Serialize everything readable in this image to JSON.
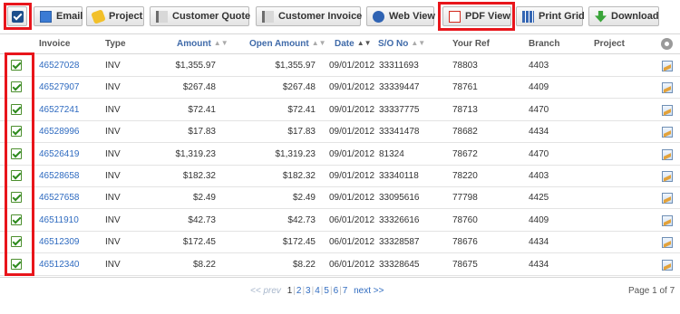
{
  "toolbar": {
    "buttons": [
      {
        "label": "Email",
        "icon": "email-icon"
      },
      {
        "label": "Project",
        "icon": "project-icon"
      },
      {
        "label": "Customer Quote",
        "icon": "quote-icon"
      },
      {
        "label": "Customer Invoice",
        "icon": "invoice-icon"
      },
      {
        "label": "Web View",
        "icon": "globe-icon"
      },
      {
        "label": "PDF View",
        "icon": "pdf-icon"
      },
      {
        "label": "Print Grid",
        "icon": "grid-icon"
      },
      {
        "label": "Download",
        "icon": "download-icon"
      }
    ],
    "highlight_color": "#e8151b"
  },
  "table": {
    "columns": {
      "invoice": "Invoice",
      "type": "Type",
      "amount": "Amount",
      "open_amount": "Open Amount",
      "date": "Date",
      "so_no": "S/O No",
      "your_ref": "Your Ref",
      "branch": "Branch",
      "project": "Project"
    },
    "rows": [
      {
        "invoice": "46527028",
        "type": "INV",
        "amount": "$1,355.97",
        "open_amount": "$1,355.97",
        "date": "09/01/2012",
        "so_no": "33311693",
        "your_ref": "78803",
        "branch": "4403",
        "project": ""
      },
      {
        "invoice": "46527907",
        "type": "INV",
        "amount": "$267.48",
        "open_amount": "$267.48",
        "date": "09/01/2012",
        "so_no": "33339447",
        "your_ref": "78761",
        "branch": "4409",
        "project": ""
      },
      {
        "invoice": "46527241",
        "type": "INV",
        "amount": "$72.41",
        "open_amount": "$72.41",
        "date": "09/01/2012",
        "so_no": "33337775",
        "your_ref": "78713",
        "branch": "4470",
        "project": ""
      },
      {
        "invoice": "46528996",
        "type": "INV",
        "amount": "$17.83",
        "open_amount": "$17.83",
        "date": "09/01/2012",
        "so_no": "33341478",
        "your_ref": "78682",
        "branch": "4434",
        "project": ""
      },
      {
        "invoice": "46526419",
        "type": "INV",
        "amount": "$1,319.23",
        "open_amount": "$1,319.23",
        "date": "09/01/2012",
        "so_no": "81324",
        "your_ref": "78672",
        "branch": "4470",
        "project": ""
      },
      {
        "invoice": "46528658",
        "type": "INV",
        "amount": "$182.32",
        "open_amount": "$182.32",
        "date": "09/01/2012",
        "so_no": "33340118",
        "your_ref": "78220",
        "branch": "4403",
        "project": ""
      },
      {
        "invoice": "46527658",
        "type": "INV",
        "amount": "$2.49",
        "open_amount": "$2.49",
        "date": "09/01/2012",
        "so_no": "33095616",
        "your_ref": "77798",
        "branch": "4425",
        "project": ""
      },
      {
        "invoice": "46511910",
        "type": "INV",
        "amount": "$42.73",
        "open_amount": "$42.73",
        "date": "06/01/2012",
        "so_no": "33326616",
        "your_ref": "78760",
        "branch": "4409",
        "project": ""
      },
      {
        "invoice": "46512309",
        "type": "INV",
        "amount": "$172.45",
        "open_amount": "$172.45",
        "date": "06/01/2012",
        "so_no": "33328587",
        "your_ref": "78676",
        "branch": "4434",
        "project": ""
      },
      {
        "invoice": "46512340",
        "type": "INV",
        "amount": "$8.22",
        "open_amount": "$8.22",
        "date": "06/01/2012",
        "so_no": "33328645",
        "your_ref": "78675",
        "branch": "4434",
        "project": ""
      }
    ]
  },
  "pagination": {
    "prev": "<< prev",
    "pages": [
      "1",
      "2",
      "3",
      "4",
      "5",
      "6",
      "7"
    ],
    "current": "1",
    "next": "next >>",
    "page_info": "Page 1 of 7"
  }
}
